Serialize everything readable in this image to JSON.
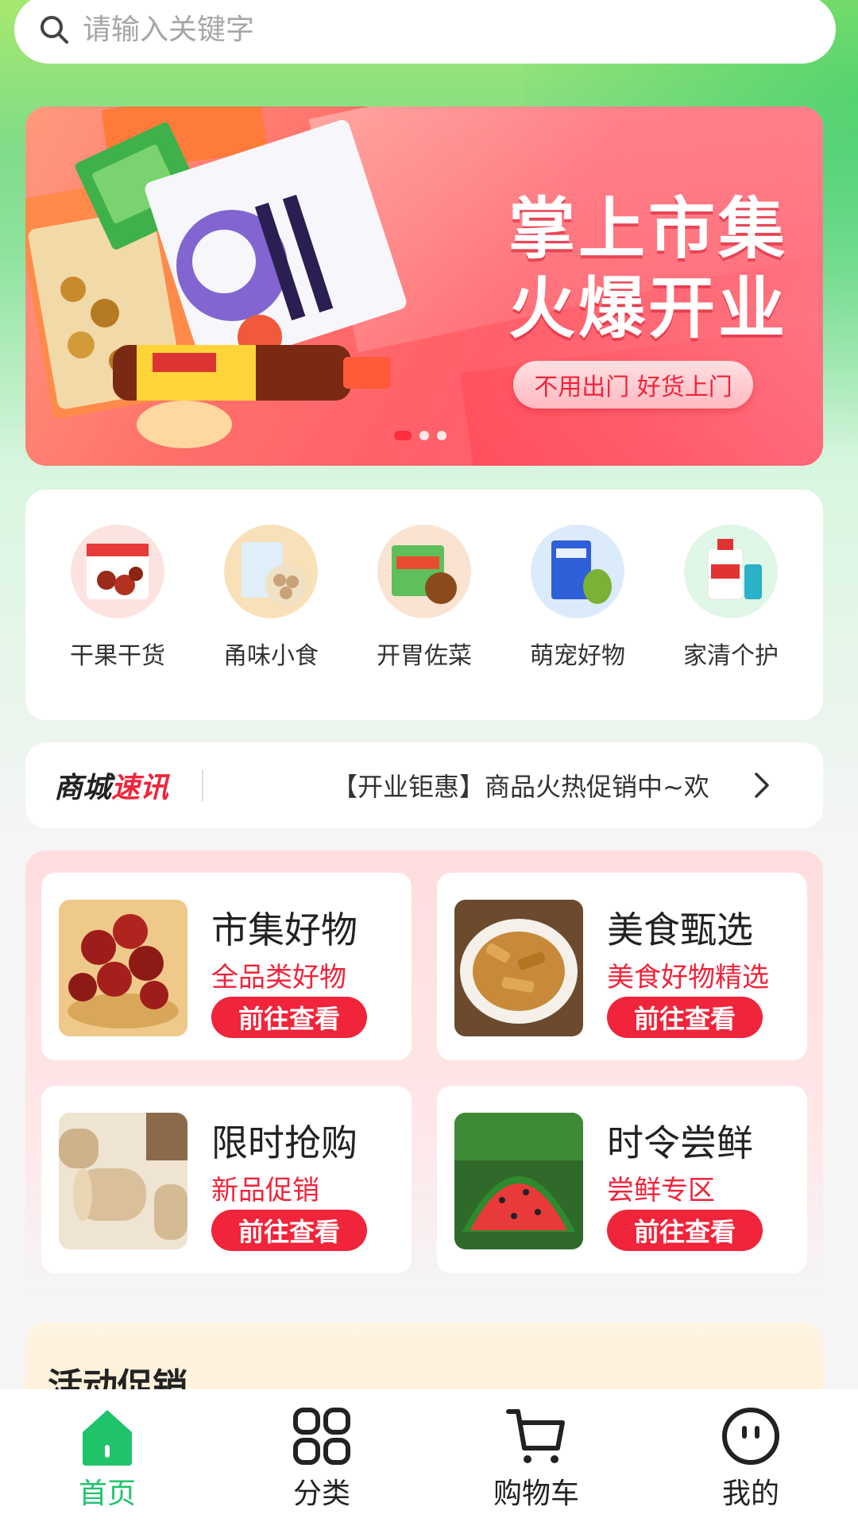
{
  "search": {
    "placeholder": "请输入关键字"
  },
  "banner": {
    "headline_line1": "掌上市集",
    "headline_line2": "火爆开业",
    "tagline": "不用出门 好货上门",
    "carousel_pages": 3,
    "active_page": 1
  },
  "categories": [
    {
      "label": "干果干货"
    },
    {
      "label": "甬味小食"
    },
    {
      "label": "开胃佐菜"
    },
    {
      "label": "萌宠好物"
    },
    {
      "label": "家清个护"
    }
  ],
  "news": {
    "brand_part1": "商城",
    "brand_part2": "速讯",
    "message": "【开业钜惠】商品火热促销中~欢"
  },
  "feature_cards": [
    {
      "title": "市集好物",
      "subtitle": "全品类好物",
      "button": "前往查看"
    },
    {
      "title": "美食甄选",
      "subtitle": "美食好物精选",
      "button": "前往查看"
    },
    {
      "title": "限时抢购",
      "subtitle": "新品促销",
      "button": "前往查看"
    },
    {
      "title": "时令尝鲜",
      "subtitle": "尝鲜专区",
      "button": "前往查看"
    }
  ],
  "promo": {
    "title": "活动促销"
  },
  "tabbar": [
    {
      "label": "首页",
      "icon": "home-icon",
      "active": true
    },
    {
      "label": "分类",
      "icon": "grid-icon",
      "active": false
    },
    {
      "label": "购物车",
      "icon": "cart-icon",
      "active": false
    },
    {
      "label": "我的",
      "icon": "profile-icon",
      "active": false
    }
  ],
  "colors": {
    "accent": "#f0243a",
    "active_tab": "#1fc36a"
  }
}
